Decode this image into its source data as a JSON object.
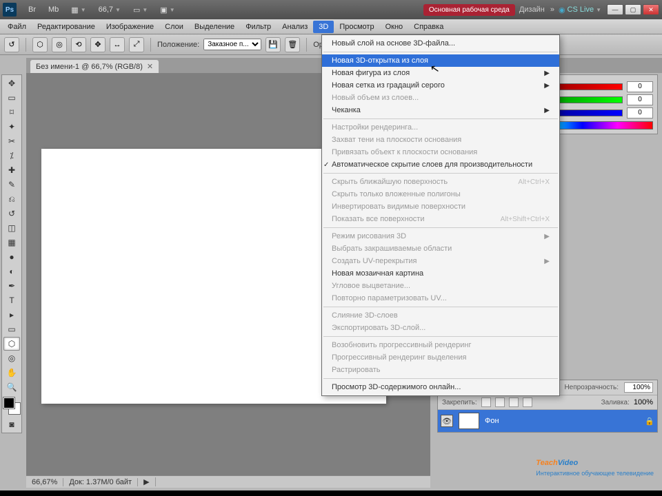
{
  "titlebar": {
    "zoom_label": "66,7",
    "workspace": "Основная рабочая среда",
    "design": "Дизайн",
    "cslive": "CS Live"
  },
  "menu": {
    "items": [
      "Файл",
      "Редактирование",
      "Изображение",
      "Слои",
      "Выделение",
      "Фильтр",
      "Анализ",
      "3D",
      "Просмотр",
      "Окно",
      "Справка"
    ],
    "active_index": 7
  },
  "optbar": {
    "position_label": "Положение:",
    "position_value": "Заказное п...",
    "orient_label": "Ориент"
  },
  "doc": {
    "tab": "Без имени-1 @ 66,7% (RGB/8)"
  },
  "rgb": {
    "r": "0",
    "g": "0",
    "b": "0"
  },
  "layers": {
    "opacity_label": "Непрозрачность:",
    "opacity_value": "100%",
    "fill_label": "Заливка:",
    "fill_value": "100%",
    "lock_label": "Закрепить:",
    "layer_name": "Фон"
  },
  "status": {
    "zoom": "66,67%",
    "doc": "Док: 1.37M/0 байт"
  },
  "dropdown": {
    "items": [
      {
        "label": "Новый слой на основе 3D-файла...",
        "type": "item"
      },
      {
        "type": "sep"
      },
      {
        "label": "Новая 3D-открытка из слоя",
        "type": "item",
        "hover": true
      },
      {
        "label": "Новая фигура из слоя",
        "type": "item",
        "sub": true
      },
      {
        "label": "Новая сетка из градаций серого",
        "type": "item",
        "sub": true
      },
      {
        "label": "Новый объем из слоев...",
        "type": "item",
        "disabled": true
      },
      {
        "label": "Чеканка",
        "type": "item",
        "sub": true
      },
      {
        "type": "sep"
      },
      {
        "label": "Настройки рендеринга...",
        "type": "item",
        "disabled": true
      },
      {
        "label": "Захват тени на плоскости основания",
        "type": "item",
        "disabled": true
      },
      {
        "label": "Привязать объект к плоскости основания",
        "type": "item",
        "disabled": true
      },
      {
        "label": "Автоматическое скрытие слоев для производительности",
        "type": "item",
        "checked": true
      },
      {
        "type": "sep"
      },
      {
        "label": "Скрыть ближайшую поверхность",
        "type": "item",
        "disabled": true,
        "shortcut": "Alt+Ctrl+X"
      },
      {
        "label": "Скрыть только вложенные полигоны",
        "type": "item",
        "disabled": true
      },
      {
        "label": "Инвертировать видимые поверхности",
        "type": "item",
        "disabled": true
      },
      {
        "label": "Показать все поверхности",
        "type": "item",
        "disabled": true,
        "shortcut": "Alt+Shift+Ctrl+X"
      },
      {
        "type": "sep"
      },
      {
        "label": "Режим рисования 3D",
        "type": "item",
        "disabled": true,
        "sub": true
      },
      {
        "label": "Выбрать закрашиваемые области",
        "type": "item",
        "disabled": true
      },
      {
        "label": "Создать UV-перекрытия",
        "type": "item",
        "disabled": true,
        "sub": true
      },
      {
        "label": "Новая мозаичная картина",
        "type": "item"
      },
      {
        "label": "Угловое выцветание...",
        "type": "item",
        "disabled": true
      },
      {
        "label": "Повторно параметризовать UV...",
        "type": "item",
        "disabled": true
      },
      {
        "type": "sep"
      },
      {
        "label": "Слияние 3D-слоев",
        "type": "item",
        "disabled": true
      },
      {
        "label": "Экспортировать 3D-слой...",
        "type": "item",
        "disabled": true
      },
      {
        "type": "sep"
      },
      {
        "label": "Возобновить прогрессивный рендеринг",
        "type": "item",
        "disabled": true
      },
      {
        "label": "Прогрессивный рендеринг выделения",
        "type": "item",
        "disabled": true
      },
      {
        "label": "Растрировать",
        "type": "item",
        "disabled": true
      },
      {
        "type": "sep"
      },
      {
        "label": "Просмотр 3D-содержимого онлайн...",
        "type": "item"
      }
    ]
  },
  "watermark": {
    "t": "Teach",
    "v": "Video",
    "sub": "Интерактивное обучающее телевидение"
  }
}
